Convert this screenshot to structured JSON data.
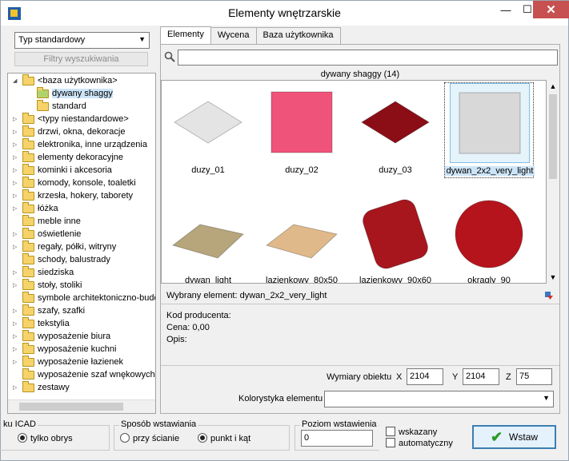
{
  "window": {
    "title": "Elementy wnętrzarskie",
    "minimize": "—",
    "maximize": "☐",
    "close": "✕"
  },
  "left": {
    "type_select": "Typ standardowy",
    "filter_button": "Filtry wyszukiwania",
    "tree": [
      {
        "label": "<baza użytkownika>",
        "level": 0,
        "expander": "◢",
        "icon": "folder-icon"
      },
      {
        "label": "dywany shaggy",
        "level": 1,
        "expander": "",
        "icon": "folder-icon-green",
        "selected": true
      },
      {
        "label": "standard",
        "level": 1,
        "expander": "",
        "icon": "folder-icon"
      },
      {
        "label": "<typy niestandardowe>",
        "level": 0,
        "expander": "▷",
        "icon": "folder-icon"
      },
      {
        "label": "drzwi, okna, dekoracje",
        "level": 0,
        "expander": "▷",
        "icon": "folder-icon"
      },
      {
        "label": "elektronika, inne urządzenia",
        "level": 0,
        "expander": "▷",
        "icon": "folder-icon"
      },
      {
        "label": "elementy dekoracyjne",
        "level": 0,
        "expander": "▷",
        "icon": "folder-icon"
      },
      {
        "label": "kominki i akcesoria",
        "level": 0,
        "expander": "▷",
        "icon": "folder-icon"
      },
      {
        "label": "komody, konsole, toaletki",
        "level": 0,
        "expander": "▷",
        "icon": "folder-icon"
      },
      {
        "label": "krzesła, hokery, taborety",
        "level": 0,
        "expander": "▷",
        "icon": "folder-icon"
      },
      {
        "label": "łóżka",
        "level": 0,
        "expander": "▷",
        "icon": "folder-icon"
      },
      {
        "label": "meble inne",
        "level": 0,
        "expander": "",
        "icon": "folder-icon"
      },
      {
        "label": "oświetlenie",
        "level": 0,
        "expander": "▷",
        "icon": "folder-icon"
      },
      {
        "label": "regały, półki, witryny",
        "level": 0,
        "expander": "▷",
        "icon": "folder-icon"
      },
      {
        "label": "schody, balustrady",
        "level": 0,
        "expander": "",
        "icon": "folder-icon"
      },
      {
        "label": "siedziska",
        "level": 0,
        "expander": "▷",
        "icon": "folder-icon"
      },
      {
        "label": "stoły, stoliki",
        "level": 0,
        "expander": "▷",
        "icon": "folder-icon"
      },
      {
        "label": "symbole architektoniczno-budo",
        "level": 0,
        "expander": "",
        "icon": "folder-icon"
      },
      {
        "label": "szafy, szafki",
        "level": 0,
        "expander": "▷",
        "icon": "folder-icon"
      },
      {
        "label": "tekstylia",
        "level": 0,
        "expander": "▷",
        "icon": "folder-icon"
      },
      {
        "label": "wyposażenie biura",
        "level": 0,
        "expander": "▷",
        "icon": "folder-icon"
      },
      {
        "label": "wyposażenie kuchni",
        "level": 0,
        "expander": "▷",
        "icon": "folder-icon"
      },
      {
        "label": "wyposażenie łazienek",
        "level": 0,
        "expander": "▷",
        "icon": "folder-icon"
      },
      {
        "label": "wyposażenie szaf wnękowych",
        "level": 0,
        "expander": "",
        "icon": "folder-icon"
      },
      {
        "label": "zestawy",
        "level": 0,
        "expander": "▷",
        "icon": "folder-icon"
      }
    ]
  },
  "tabs": [
    "Elementy",
    "Wycena",
    "Baza użytkownika"
  ],
  "search": {
    "placeholder": ""
  },
  "group_header": "dywany shaggy (14)",
  "items": [
    {
      "label": "duzy_01",
      "color": "#e4e4e4",
      "shape": "diamond"
    },
    {
      "label": "duzy_02",
      "color": "#f0537a",
      "shape": "square"
    },
    {
      "label": "duzy_03",
      "color": "#8b0d16",
      "shape": "diamond"
    },
    {
      "label": "dywan_2x2_very_light",
      "color": "#d8d8d8",
      "shape": "square",
      "selected": true
    },
    {
      "label": "dywan_light",
      "color": "#b7a57c",
      "shape": "rect"
    },
    {
      "label": "lazienkowy_80x50",
      "color": "#e0b98a",
      "shape": "rect"
    },
    {
      "label": "lazienkowy_90x60",
      "color": "#a7161d",
      "shape": "rounded"
    },
    {
      "label": "okragly_90",
      "color": "#b5141c",
      "shape": "circle"
    }
  ],
  "selected_element": "Wybrany element: dywan_2x2_very_light",
  "properties": {
    "producer_code": "Kod producenta:",
    "price": "Cena: 0,00",
    "description": "Opis:"
  },
  "dimensions": {
    "label": "Wymiary obiektu",
    "x_label": "X",
    "x": "2104",
    "y_label": "Y",
    "y": "2104",
    "z_label": "Z",
    "z": "75"
  },
  "color_scheme": {
    "label": "Kolorystyka elementu",
    "value": ""
  },
  "bottom": {
    "icad_group_title": "ku ICAD",
    "icad_option": "tylko obrys",
    "insert_method_title": "Sposób wstawiania",
    "insert_wall": "przy ścianie",
    "insert_point": "punkt i kąt",
    "level_title": "Poziom wstawienia",
    "level_value": "0",
    "chk_indicated": "wskazany",
    "chk_auto": "automatyczny",
    "insert_button": "Wstaw"
  }
}
